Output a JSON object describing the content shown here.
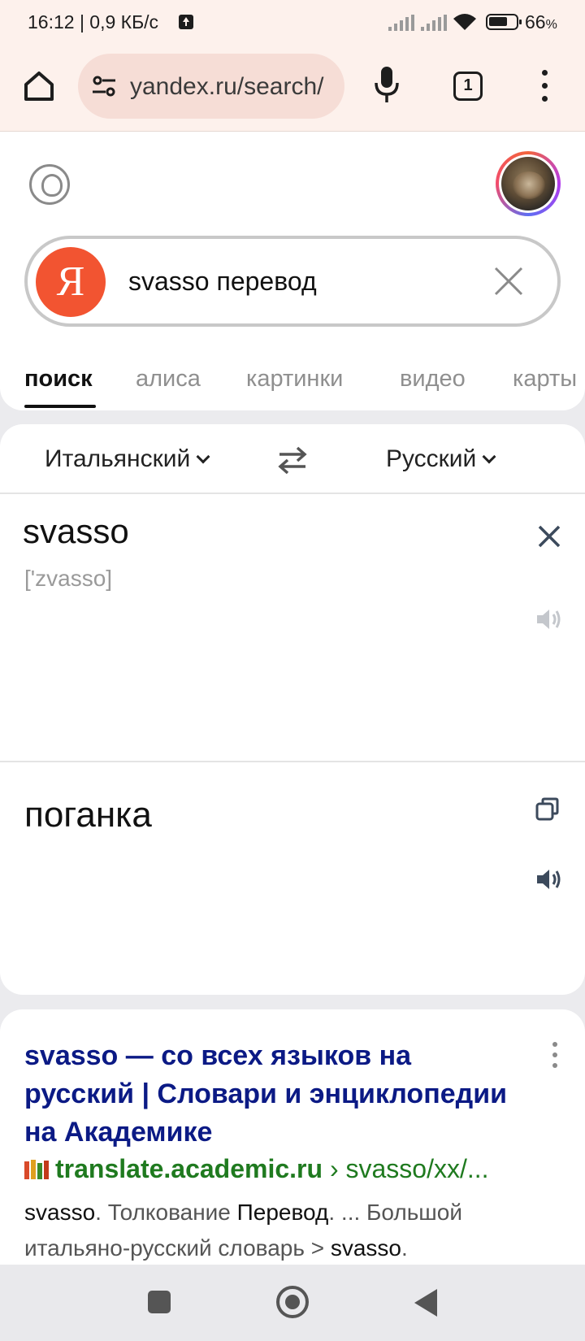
{
  "status_bar": {
    "time_speed": "16:12 | 0,9 КБ/с",
    "battery_percent": "66",
    "battery_suffix": "%",
    "battery_level": 0.66
  },
  "browser": {
    "url": "yandex.ru/search/",
    "tab_count": "1"
  },
  "search": {
    "logo_letter": "Я",
    "query": "svasso перевод",
    "tabs": [
      "поиск",
      "алиса",
      "картинки",
      "видео",
      "карты"
    ]
  },
  "translator": {
    "source_lang": "Итальянский",
    "target_lang": "Русский",
    "source_word": "svasso",
    "transcription": "['zvasso]",
    "translation": "поганка"
  },
  "result": {
    "title": "svasso — со всех языков на русский | Словари и энциклопедии на Академике",
    "domain": "translate.academic.ru",
    "path": " › svasso/xx/...",
    "snippet": {
      "w1": "svasso",
      "t1": ". Толкование ",
      "w2": "Перевод",
      "t2": ". ... Большой итальяно-русский словарь > ",
      "w3": "svasso",
      "t3": "."
    }
  },
  "colors": {
    "accent_yandex": "#f25431",
    "link_title": "#0b1a85",
    "link_url": "#1f7a1f",
    "browser_bar": "#fdf1ec"
  }
}
